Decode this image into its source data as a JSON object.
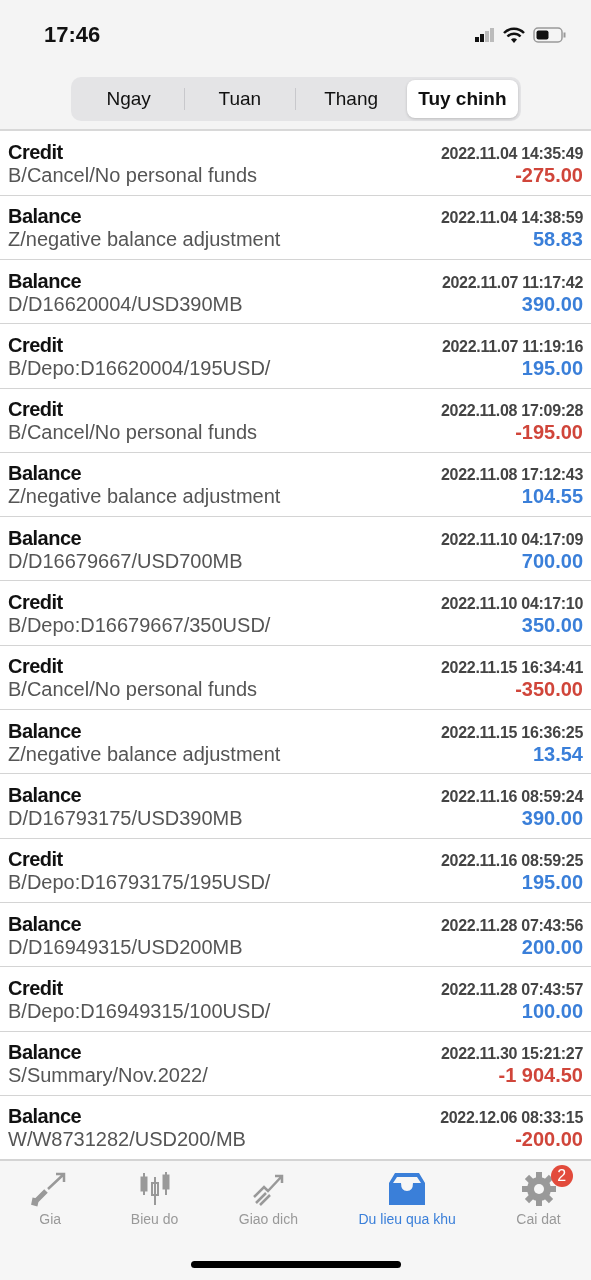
{
  "status_bar": {
    "time": "17:46"
  },
  "tabs": [
    {
      "label": "Ngay",
      "selected": false
    },
    {
      "label": "Tuan",
      "selected": false
    },
    {
      "label": "Thang",
      "selected": false
    },
    {
      "label": "Tuy chinh",
      "selected": true
    }
  ],
  "rows": [
    {
      "type": "Credit",
      "time": "2022.11.04 14:35:49",
      "comment": "B/Cancel/No personal funds",
      "amount": "-275.00",
      "color": "#d0453a"
    },
    {
      "type": "Balance",
      "time": "2022.11.04 14:38:59",
      "comment": "Z/negative balance adjustment",
      "amount": "58.83",
      "color": "#3a7fd9"
    },
    {
      "type": "Balance",
      "time": "2022.11.07 11:17:42",
      "comment": "D/D16620004/USD390MB",
      "amount": "390.00",
      "color": "#3a7fd9"
    },
    {
      "type": "Credit",
      "time": "2022.11.07 11:19:16",
      "comment": "B/Depo:D16620004/195USD/",
      "amount": "195.00",
      "color": "#3a7fd9"
    },
    {
      "type": "Credit",
      "time": "2022.11.08 17:09:28",
      "comment": "B/Cancel/No personal funds",
      "amount": "-195.00",
      "color": "#d0453a"
    },
    {
      "type": "Balance",
      "time": "2022.11.08 17:12:43",
      "comment": "Z/negative balance adjustment",
      "amount": "104.55",
      "color": "#3a7fd9"
    },
    {
      "type": "Balance",
      "time": "2022.11.10 04:17:09",
      "comment": "D/D16679667/USD700MB",
      "amount": "700.00",
      "color": "#3a7fd9"
    },
    {
      "type": "Credit",
      "time": "2022.11.10 04:17:10",
      "comment": "B/Depo:D16679667/350USD/",
      "amount": "350.00",
      "color": "#3a7fd9"
    },
    {
      "type": "Credit",
      "time": "2022.11.15 16:34:41",
      "comment": "B/Cancel/No personal funds",
      "amount": "-350.00",
      "color": "#d0453a"
    },
    {
      "type": "Balance",
      "time": "2022.11.15 16:36:25",
      "comment": "Z/negative balance adjustment",
      "amount": "13.54",
      "color": "#3a7fd9"
    },
    {
      "type": "Balance",
      "time": "2022.11.16 08:59:24",
      "comment": "D/D16793175/USD390MB",
      "amount": "390.00",
      "color": "#3a7fd9"
    },
    {
      "type": "Credit",
      "time": "2022.11.16 08:59:25",
      "comment": "B/Depo:D16793175/195USD/",
      "amount": "195.00",
      "color": "#3a7fd9"
    },
    {
      "type": "Balance",
      "time": "2022.11.28 07:43:56",
      "comment": "D/D16949315/USD200MB",
      "amount": "200.00",
      "color": "#3a7fd9"
    },
    {
      "type": "Credit",
      "time": "2022.11.28 07:43:57",
      "comment": "B/Depo:D16949315/100USD/",
      "amount": "100.00",
      "color": "#3a7fd9"
    },
    {
      "type": "Balance",
      "time": "2022.11.30 15:21:27",
      "comment": "S/Summary/Nov.2022/",
      "amount": "-1 904.50",
      "color": "#d0453a"
    },
    {
      "type": "Balance",
      "time": "2022.12.06 08:33:15",
      "comment": "W/W8731282/USD200/MB",
      "amount": "-200.00",
      "color": "#d0453a"
    }
  ],
  "nav": [
    {
      "kind": "quotes",
      "label": "Gia",
      "selected": false
    },
    {
      "kind": "chart",
      "label": "Bieu do",
      "selected": false
    },
    {
      "kind": "trade",
      "label": "Giao dich",
      "selected": false
    },
    {
      "kind": "history",
      "label": "Du lieu qua khu",
      "selected": true
    },
    {
      "kind": "settings",
      "label": "Cai dat",
      "selected": false,
      "badge": "2"
    }
  ]
}
